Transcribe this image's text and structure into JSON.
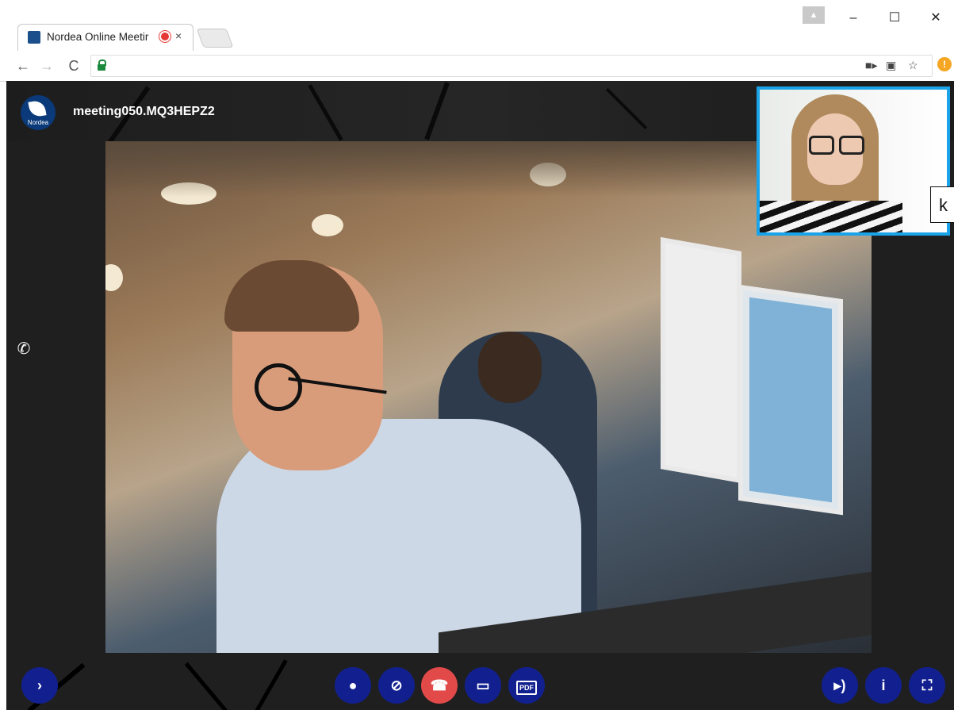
{
  "browser": {
    "tab_title": "Nordea Online Meetir",
    "tab_close": "×",
    "recording_indicator": "record-dot-icon",
    "window_controls": {
      "minimize": "–",
      "maximize": "☐",
      "close": "✕"
    },
    "nav": {
      "back": "←",
      "forward": "→",
      "reload": "C"
    },
    "address": "",
    "omnibox_icons": [
      "camera-icon",
      "translate-icon",
      "star-icon"
    ],
    "extension_badge": "!"
  },
  "meeting": {
    "logo_text": "Nordea",
    "meeting_id": "meeting050.MQ3HEPZ2",
    "self_view_overlay_text": "k",
    "side_icon": "phone-ringing-icon"
  },
  "controls": {
    "left": [
      {
        "name": "expand",
        "glyph": "›"
      }
    ],
    "center": [
      {
        "name": "microphone",
        "glyph": "🎤"
      },
      {
        "name": "camera-off",
        "glyph": "⊘"
      },
      {
        "name": "hang-up",
        "glyph": "☎"
      },
      {
        "name": "share-screen",
        "glyph": "▭"
      },
      {
        "name": "pdf",
        "glyph": "PDF"
      }
    ],
    "right": [
      {
        "name": "volume",
        "glyph": "🔊"
      },
      {
        "name": "info",
        "glyph": "i"
      },
      {
        "name": "fullscreen",
        "glyph": "⛶"
      }
    ]
  },
  "colors": {
    "control_blue": "#12208f",
    "hangup_red": "#e24a4a",
    "self_view_border": "#1aa3e8",
    "lock_green": "#1b8a3c"
  }
}
